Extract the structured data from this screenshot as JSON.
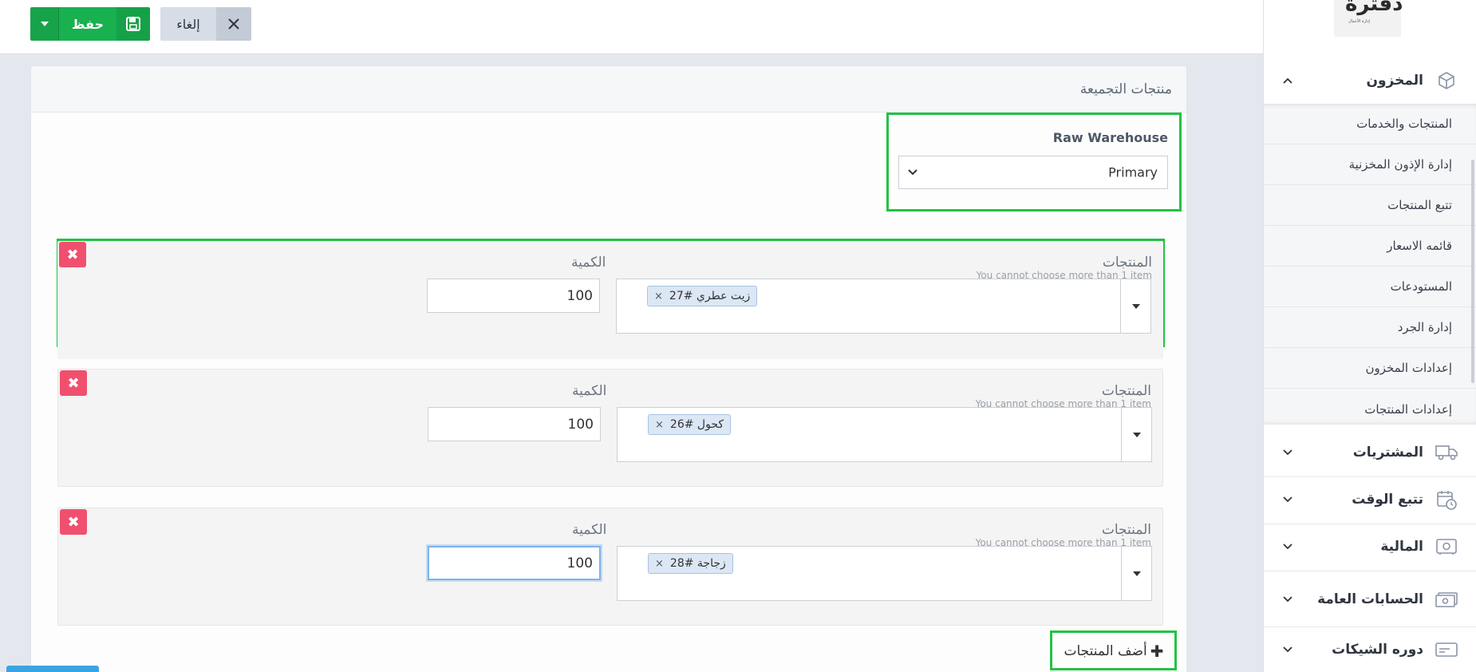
{
  "toolbar": {
    "save_label": "حفظ",
    "cancel_label": "إلغاء"
  },
  "sidebar": {
    "logo_text": "دفترة",
    "logo_tagline": "إدارة الأعمال",
    "inventory_label": "المخزون",
    "sub_items": [
      "المنتجات والخدمات",
      "إدارة الإذون المخزنية",
      "تتبع المنتجات",
      "قائمه الاسعار",
      "المستودعات",
      "إدارة الجرد",
      "إعدادات المخزون",
      "إعدادات المنتجات"
    ],
    "sections": [
      {
        "label": "المشتريات",
        "icon": "truck-icon"
      },
      {
        "label": "تتبع الوقت",
        "icon": "calendar-clock-icon"
      },
      {
        "label": "المالية",
        "icon": "safe-icon"
      },
      {
        "label": "الحسابات العامة",
        "icon": "money-icon"
      },
      {
        "label": "دوره الشيكات",
        "icon": "check-card-icon"
      }
    ]
  },
  "card": {
    "title": "منتجات التجميعة"
  },
  "warehouse": {
    "label": "Raw Warehouse",
    "selected": "Primary"
  },
  "rows": {
    "products_label": "المنتجات",
    "qty_label": "الكمية",
    "hint": "You cannot choose more than 1 item",
    "items": [
      {
        "product": "زيت عطري #27",
        "qty": "100"
      },
      {
        "product": "كحول #26",
        "qty": "100"
      },
      {
        "product": "زجاجة #28",
        "qty": "100"
      }
    ]
  },
  "add_products_label": "أضف المنتجات",
  "colors": {
    "save_green": "#19b04f",
    "highlight_green": "#22c244",
    "remove_red": "#f0506e",
    "chip_blue": "#dbe7f5"
  }
}
